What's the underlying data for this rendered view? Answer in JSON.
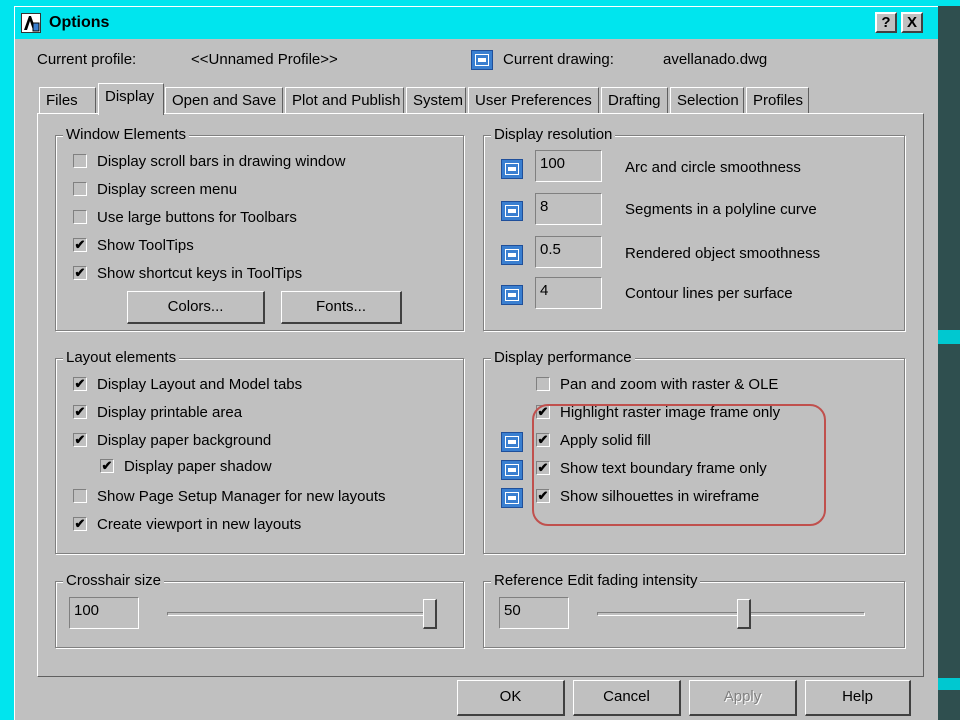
{
  "window": {
    "title": "Options",
    "help_glyph": "?",
    "close_glyph": "X"
  },
  "profile": {
    "label": "Current profile:",
    "value": "<<Unnamed Profile>>",
    "drawing_label": "Current drawing:",
    "drawing_value": "avellanado.dwg"
  },
  "tabs": [
    "Files",
    "Display",
    "Open and Save",
    "Plot and Publish",
    "System",
    "User Preferences",
    "Drafting",
    "Selection",
    "Profiles"
  ],
  "active_tab": "Display",
  "window_elements": {
    "title": "Window Elements",
    "items": [
      {
        "label": "Display scroll bars in drawing window",
        "checked": false
      },
      {
        "label": "Display screen menu",
        "checked": false
      },
      {
        "label": "Use large buttons for Toolbars",
        "checked": false
      },
      {
        "label": "Show ToolTips",
        "checked": true
      },
      {
        "label": "Show shortcut keys in ToolTips",
        "checked": true
      }
    ],
    "colors_button": "Colors...",
    "fonts_button": "Fonts..."
  },
  "display_resolution": {
    "title": "Display resolution",
    "items": [
      {
        "value": "100",
        "label": "Arc and circle smoothness"
      },
      {
        "value": "8",
        "label": "Segments in a polyline curve"
      },
      {
        "value": "0.5",
        "label": "Rendered object smoothness"
      },
      {
        "value": "4",
        "label": "Contour lines per surface"
      }
    ]
  },
  "layout_elements": {
    "title": "Layout elements",
    "items": [
      {
        "label": "Display Layout and Model tabs",
        "checked": true
      },
      {
        "label": "Display printable area",
        "checked": true
      },
      {
        "label": "Display paper background",
        "checked": true
      },
      {
        "label": "Display paper shadow",
        "checked": true
      },
      {
        "label": "Show Page Setup Manager for new layouts",
        "checked": false
      },
      {
        "label": "Create viewport in new layouts",
        "checked": true
      }
    ]
  },
  "display_performance": {
    "title": "Display performance",
    "items": [
      {
        "label": "Pan and zoom with raster & OLE",
        "checked": false
      },
      {
        "label": "Highlight raster image frame only",
        "checked": true
      },
      {
        "label": "Apply solid fill",
        "checked": true
      },
      {
        "label": "Show text boundary frame only",
        "checked": true
      },
      {
        "label": "Show silhouettes in wireframe",
        "checked": true
      }
    ]
  },
  "crosshair": {
    "title": "Crosshair size",
    "value": "100",
    "slider_fraction": 1.0
  },
  "xref_fading": {
    "title": "Reference Edit fading intensity",
    "value": "50",
    "slider_fraction": 0.55
  },
  "buttons": {
    "ok": "OK",
    "cancel": "Cancel",
    "apply": "Apply",
    "help": "Help"
  },
  "colors": {
    "titlebar": "#00e5ee",
    "dialog": "#c0c0c0",
    "highlight_ring": "#c0504d",
    "icon_blue": "#3a7fd0"
  }
}
